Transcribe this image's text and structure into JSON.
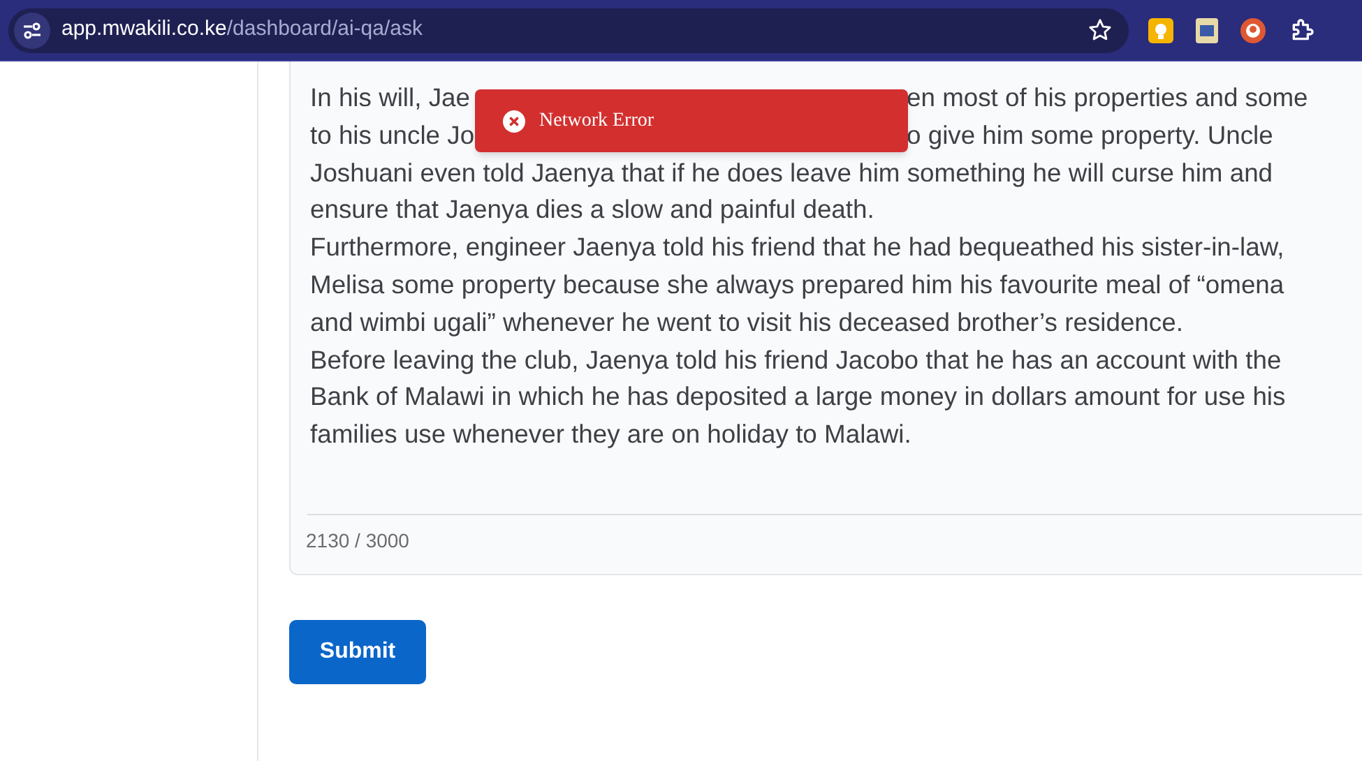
{
  "browser": {
    "url_host": "app.mwakili.co.ke",
    "url_path": "/dashboard/ai-qa/ask"
  },
  "toast": {
    "kind": "error",
    "message": "Network Error"
  },
  "question": {
    "lines": [
      {
        "segments": [
          "In his will, Jae",
          "en most of his properties and some"
        ]
      },
      {
        "segments": [
          "to his uncle Jo",
          "o give him some property. Uncle"
        ]
      },
      {
        "segments": [
          "Joshuani even told Jaenya that if he does leave him something he will curse him and"
        ]
      },
      {
        "segments": [
          "ensure that Jaenya dies a slow and painful death."
        ]
      },
      {
        "segments": [
          "Furthermore, engineer Jaenya told his friend that he had bequeathed his sister-in-law,"
        ]
      },
      {
        "segments": [
          "Melisa some property because she always prepared him his favourite meal of “omena"
        ]
      },
      {
        "segments": [
          "and wimbi ugali” whenever he went to visit his deceased brother’s residence."
        ]
      },
      {
        "segments": [
          "Before leaving the club, Jaenya told his friend Jacobo that he has an account with the"
        ]
      },
      {
        "segments": [
          "Bank of Malawi in which he has deposited a large money in dollars amount for use his"
        ]
      },
      {
        "segments": [
          "families use whenever they are on holiday to Malawi."
        ]
      }
    ],
    "counter": "2130 / 3000"
  },
  "submit": "Submit"
}
